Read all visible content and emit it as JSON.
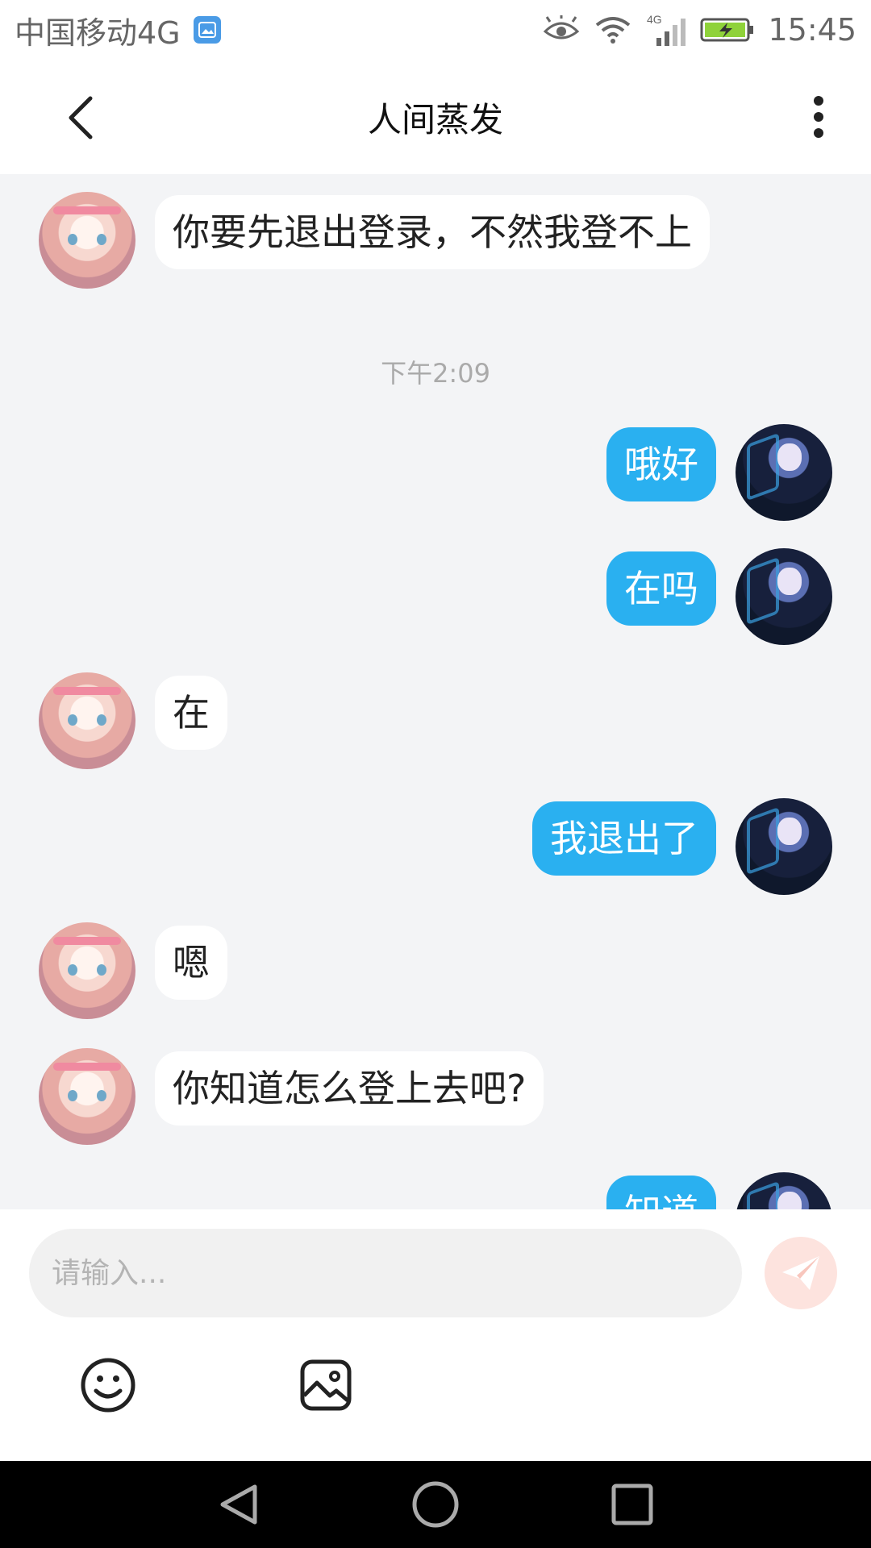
{
  "status_bar": {
    "carrier": "中国移动4G",
    "network_badge": "4G",
    "time": "15:45"
  },
  "header": {
    "title": "人间蒸发",
    "back_icon": "chevron-left-icon",
    "more_icon": "more-vertical-icon"
  },
  "chat": {
    "timestamp": "下午2:09",
    "messages": [
      {
        "side": "in",
        "text": "你要先退出登录，不然我登不上"
      },
      {
        "side": "out",
        "text": "哦好"
      },
      {
        "side": "out",
        "text": "在吗"
      },
      {
        "side": "in",
        "text": "在"
      },
      {
        "side": "out",
        "text": "我退出了"
      },
      {
        "side": "in",
        "text": "嗯"
      },
      {
        "side": "in",
        "text": "你知道怎么登上去吧?"
      },
      {
        "side": "out",
        "text": "知道"
      }
    ]
  },
  "composer": {
    "placeholder": "请输入...",
    "send_icon": "paper-plane-icon",
    "emoji_icon": "smiley-icon",
    "image_icon": "image-icon"
  },
  "nav_bar": {
    "back_icon": "triangle-back-icon",
    "home_icon": "circle-home-icon",
    "recents_icon": "square-recents-icon"
  },
  "colors": {
    "outgoing_bubble": "#2ab0f0",
    "incoming_bubble": "#ffffff",
    "chat_background": "#f3f4f6",
    "send_button": "#fde3de"
  }
}
